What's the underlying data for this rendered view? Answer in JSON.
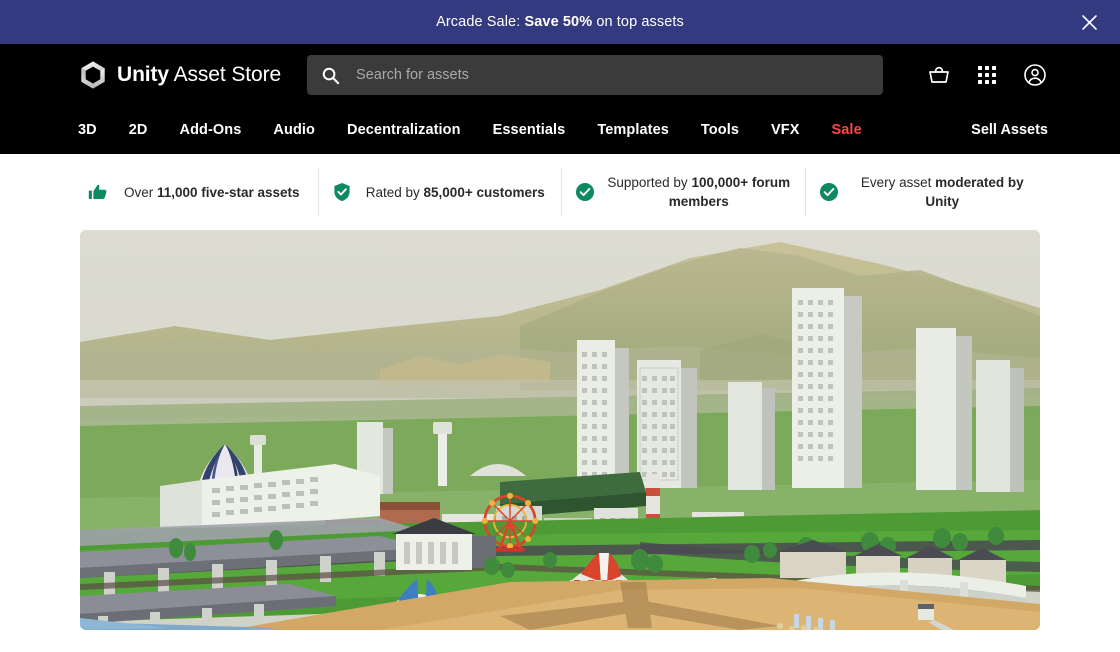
{
  "promo": {
    "text_prefix": "Arcade Sale: ",
    "text_strong": "Save 50%",
    "text_suffix": " on top assets",
    "close_icon": "close-icon",
    "background_color": "#333a80"
  },
  "header": {
    "brand": {
      "logo_icon": "unity-cube-logo-icon",
      "name_bold": "Unity",
      "name_regular": " Asset Store"
    },
    "search": {
      "icon": "search-icon",
      "placeholder": "Search for assets",
      "value": ""
    },
    "actions": [
      {
        "name": "cart-basket-icon",
        "label": "Cart"
      },
      {
        "name": "apps-grid-icon",
        "label": "Apps"
      },
      {
        "name": "user-account-icon",
        "label": "Account"
      }
    ],
    "background_color": "#000000"
  },
  "nav": {
    "items": [
      {
        "label": "3D",
        "sale": false
      },
      {
        "label": "2D",
        "sale": false
      },
      {
        "label": "Add-Ons",
        "sale": false
      },
      {
        "label": "Audio",
        "sale": false
      },
      {
        "label": "Decentralization",
        "sale": false
      },
      {
        "label": "Essentials",
        "sale": false
      },
      {
        "label": "Templates",
        "sale": false
      },
      {
        "label": "Tools",
        "sale": false
      },
      {
        "label": "VFX",
        "sale": false
      },
      {
        "label": "Sale",
        "sale": true
      }
    ],
    "sell_assets_label": "Sell Assets",
    "sale_color": "#ff4545"
  },
  "trust_bar": {
    "items": [
      {
        "icon": "thumbs-up-icon",
        "prefix": "Over ",
        "strong": "11,000 five-star assets",
        "suffix": ""
      },
      {
        "icon": "shield-check-icon",
        "prefix": "Rated by ",
        "strong": "85,000+ customers",
        "suffix": ""
      },
      {
        "icon": "check-circle-icon",
        "prefix": "Supported by ",
        "strong": "100,000+ forum members",
        "suffix": ""
      },
      {
        "icon": "check-circle-icon",
        "prefix": "Every asset ",
        "strong": "moderated by Unity",
        "suffix": ""
      }
    ],
    "icon_color": "#0d8a5f",
    "divider_color": "#e2e2e2"
  },
  "hero": {
    "alt": "Low-poly 3D city scene with hot air balloon, skyscrapers, highways, ferris wheel, circus tents and beach",
    "sky_color": "#d8d8cf",
    "grass_color": "#4e9b35",
    "sand_color": "#d3a867",
    "water_color": "#7fa8c9"
  }
}
